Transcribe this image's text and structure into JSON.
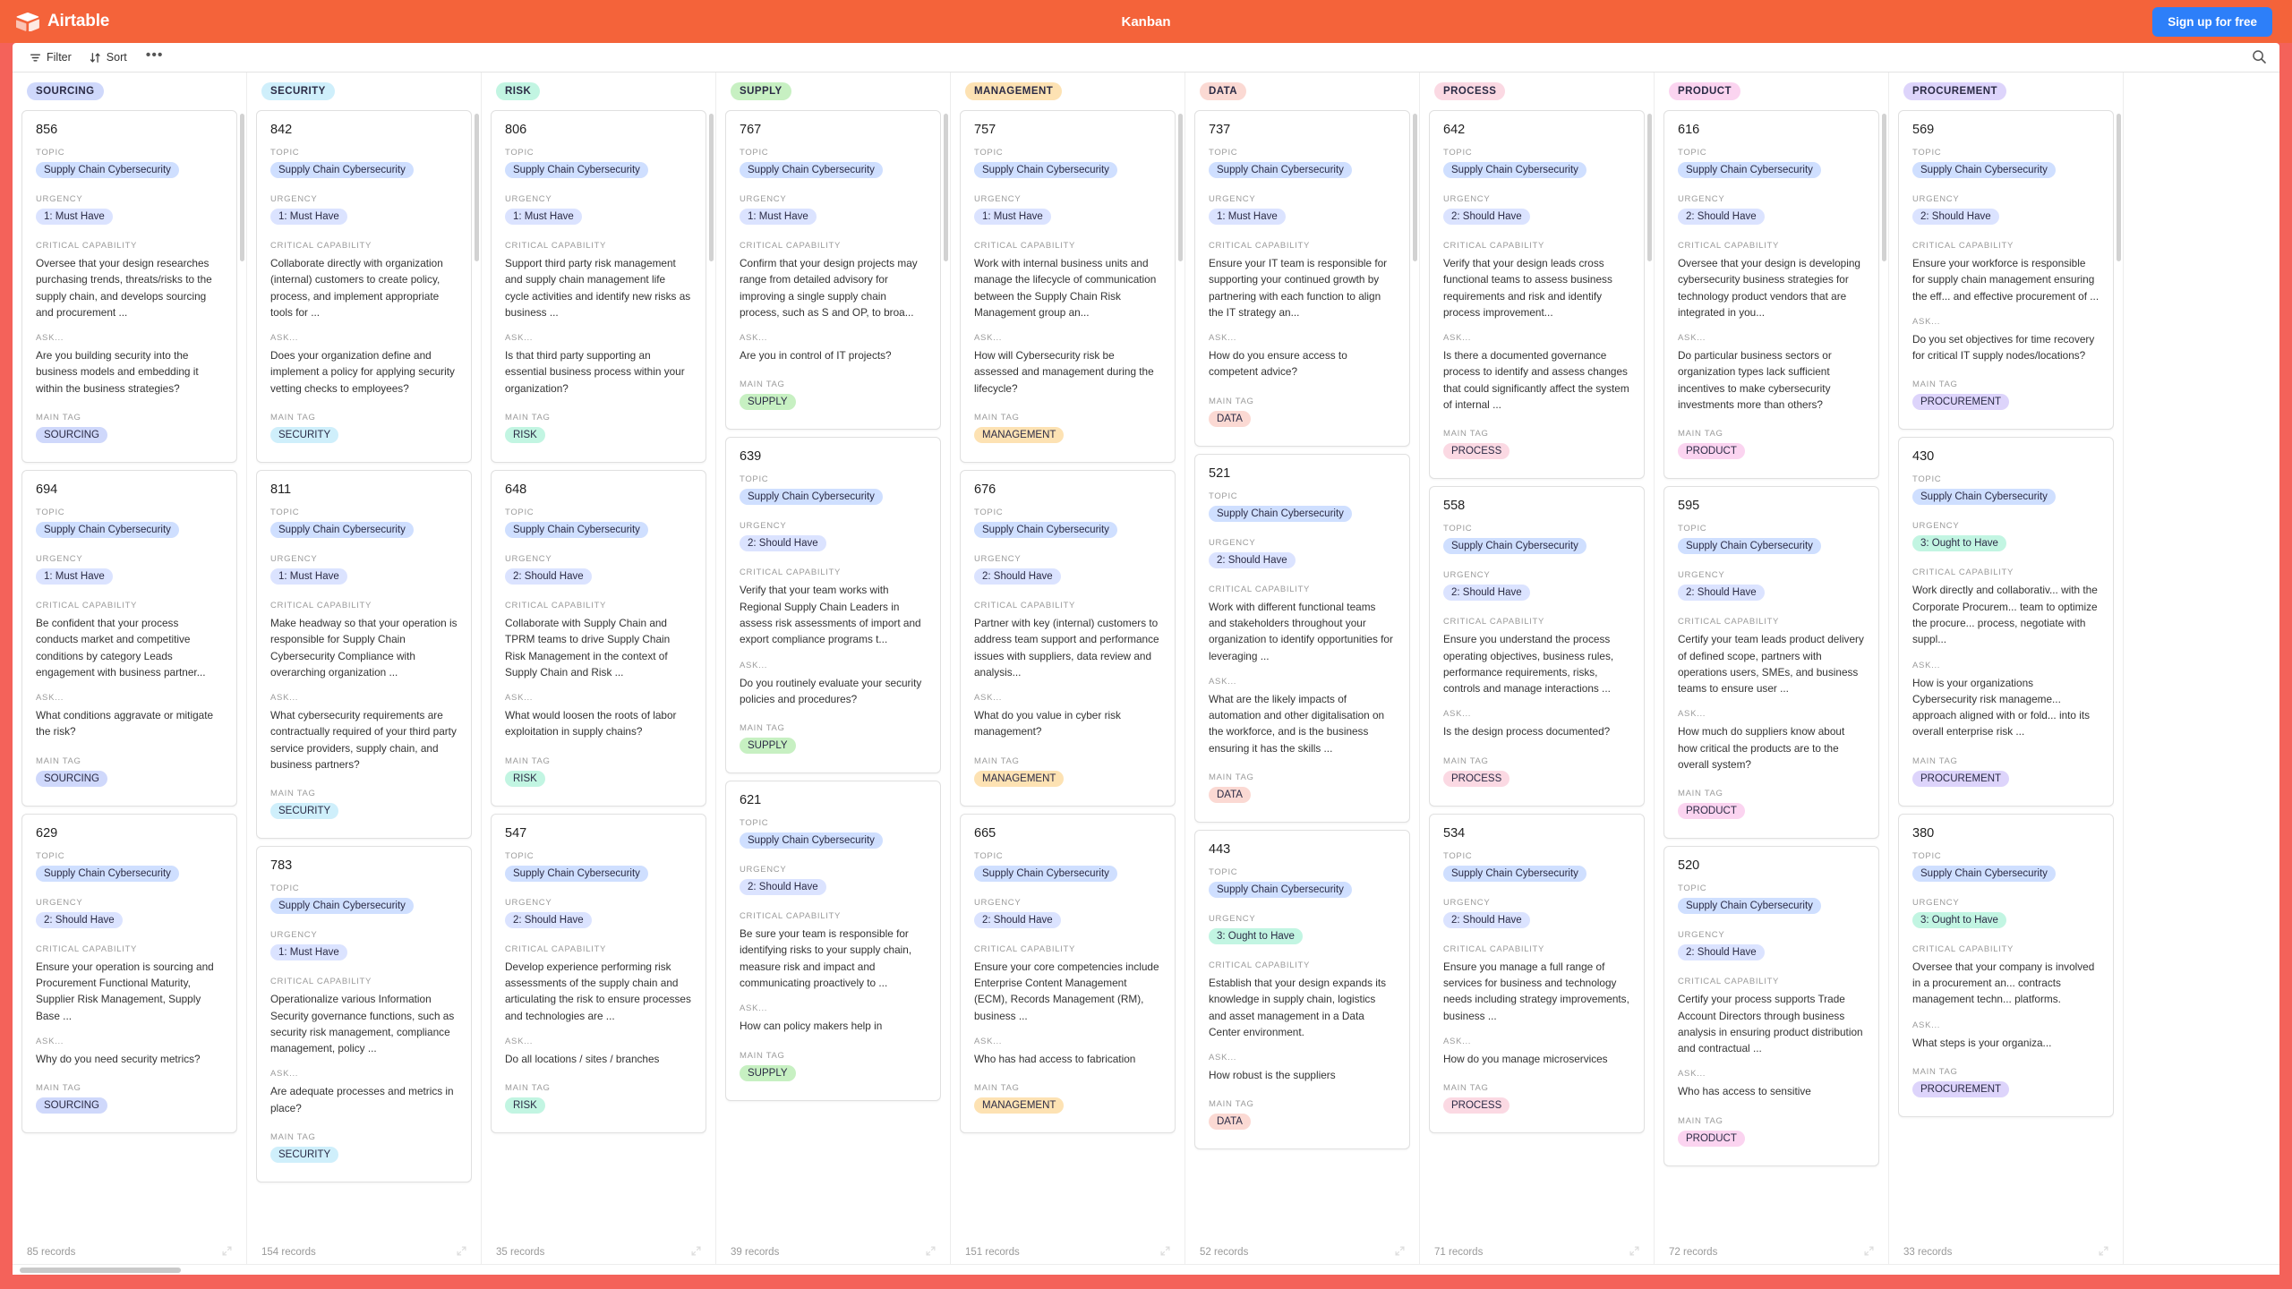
{
  "app": {
    "brand": "Airtable",
    "window_title": "Kanban",
    "signup_label": "Sign up for free",
    "brand_color": "#f4633a",
    "cta_color": "#2d7ff9"
  },
  "toolbar": {
    "filter_label": "Filter",
    "sort_label": "Sort",
    "more_label": "•••",
    "search_icon": "search-icon",
    "filter_icon": "filter-icon",
    "sort_icon": "sort-icon"
  },
  "field_labels": {
    "topic": "TOPIC",
    "urgency": "URGENCY",
    "capability": "CRITICAL CAPABILITY",
    "ask": "ASK...",
    "main_tag": "MAIN TAG"
  },
  "columns": [
    {
      "name": "SOURCING",
      "color": "#cfd8fb",
      "records": "85 records",
      "cards": [
        {
          "id": "856",
          "topic": "Supply Chain Cybersecurity",
          "urgency": "1: Must Have",
          "urgency_level": 1,
          "capability": "Oversee that your design researches purchasing trends, threats/risks to the supply chain, and develops sourcing and procurement ...",
          "ask": "Are you building security into the business models and embedding it within the business strategies?",
          "main_tag": "SOURCING"
        },
        {
          "id": "694",
          "topic": "Supply Chain Cybersecurity",
          "urgency": "1: Must Have",
          "urgency_level": 1,
          "capability": "Be confident that your process conducts market and competitive conditions by category Leads engagement with business partner...",
          "ask": "What conditions aggravate or mitigate the risk?",
          "main_tag": "SOURCING"
        },
        {
          "id": "629",
          "topic": "Supply Chain Cybersecurity",
          "urgency": "2: Should Have",
          "urgency_level": 2,
          "capability": "Ensure your operation is sourcing and Procurement Functional Maturity, Supplier Risk Management, Supply Base ...",
          "ask": "Why do you need security metrics?",
          "main_tag": "SOURCING"
        }
      ]
    },
    {
      "name": "SECURITY",
      "color": "#cfeffb",
      "records": "154 records",
      "cards": [
        {
          "id": "842",
          "topic": "Supply Chain Cybersecurity",
          "urgency": "1: Must Have",
          "urgency_level": 1,
          "capability": "Collaborate directly with organization (internal) customers to create policy, process, and implement appropriate tools for ...",
          "ask": "Does your organization define and implement a policy for applying security vetting checks to employees?",
          "main_tag": "SECURITY"
        },
        {
          "id": "811",
          "topic": "Supply Chain Cybersecurity",
          "urgency": "1: Must Have",
          "urgency_level": 1,
          "capability": "Make headway so that your operation is responsible for Supply Chain Cybersecurity Compliance with overarching organization ...",
          "ask": "What cybersecurity requirements are contractually required of your third party service providers, supply chain, and business partners?",
          "main_tag": "SECURITY"
        },
        {
          "id": "783",
          "topic": "Supply Chain Cybersecurity",
          "urgency": "1: Must Have",
          "urgency_level": 1,
          "capability": "Operationalize various Information Security governance functions, such as security risk management, compliance management, policy ...",
          "ask": "Are adequate processes and metrics in place?",
          "main_tag": "SECURITY"
        }
      ]
    },
    {
      "name": "RISK",
      "color": "#c2f5e2",
      "records": "35 records",
      "cards": [
        {
          "id": "806",
          "topic": "Supply Chain Cybersecurity",
          "urgency": "1: Must Have",
          "urgency_level": 1,
          "capability": "Support third party risk management and supply chain management life cycle activities and identify new risks as business ...",
          "ask": "Is that third party supporting an essential business process within your organization?",
          "main_tag": "RISK"
        },
        {
          "id": "648",
          "topic": "Supply Chain Cybersecurity",
          "urgency": "2: Should Have",
          "urgency_level": 2,
          "capability": "Collaborate with Supply Chain and TPRM teams to drive Supply Chain Risk Management in the context of Supply Chain and Risk ...",
          "ask": "What would loosen the roots of labor exploitation in supply chains?",
          "main_tag": "RISK"
        },
        {
          "id": "547",
          "topic": "Supply Chain Cybersecurity",
          "urgency": "2: Should Have",
          "urgency_level": 2,
          "capability": "Develop experience performing risk assessments of the supply chain and articulating the risk to ensure processes and technologies are ...",
          "ask": "Do all locations / sites / branches",
          "main_tag": "RISK"
        }
      ]
    },
    {
      "name": "SUPPLY",
      "color": "#c7f0c2",
      "records": "39 records",
      "cards": [
        {
          "id": "767",
          "topic": "Supply Chain Cybersecurity",
          "urgency": "1: Must Have",
          "urgency_level": 1,
          "capability": "Confirm that your design projects may range from detailed advisory for improving a single supply chain process, such as S and OP, to broa...",
          "ask": "Are you in control of IT projects?",
          "main_tag": "SUPPLY"
        },
        {
          "id": "639",
          "topic": "Supply Chain Cybersecurity",
          "urgency": "2: Should Have",
          "urgency_level": 2,
          "capability": "Verify that your team works with Regional Supply Chain Leaders in assess risk assessments of import and export compliance programs t...",
          "ask": "Do you routinely evaluate your security policies and procedures?",
          "main_tag": "SUPPLY"
        },
        {
          "id": "621",
          "topic": "Supply Chain Cybersecurity",
          "urgency": "2: Should Have",
          "urgency_level": 2,
          "capability": "Be sure your team is responsible for identifying risks to your supply chain, measure risk and impact and communicating proactively to ...",
          "ask": "How can policy makers help in",
          "main_tag": "SUPPLY"
        }
      ]
    },
    {
      "name": "MANAGEMENT",
      "color": "#fde2b3",
      "records": "151 records",
      "cards": [
        {
          "id": "757",
          "topic": "Supply Chain Cybersecurity",
          "urgency": "1: Must Have",
          "urgency_level": 1,
          "capability": "Work with internal business units and manage the lifecycle of communication between the Supply Chain Risk Management group an...",
          "ask": "How will Cybersecurity risk be assessed and management during the lifecycle?",
          "main_tag": "MANAGEMENT"
        },
        {
          "id": "676",
          "topic": "Supply Chain Cybersecurity",
          "urgency": "2: Should Have",
          "urgency_level": 2,
          "capability": "Partner with key (internal) customers to address team support and performance issues with suppliers, data review and analysis...",
          "ask": "What do you value in cyber risk management?",
          "main_tag": "MANAGEMENT"
        },
        {
          "id": "665",
          "topic": "Supply Chain Cybersecurity",
          "urgency": "2: Should Have",
          "urgency_level": 2,
          "capability": "Ensure your core competencies include Enterprise Content Management (ECM), Records Management (RM), business ...",
          "ask": "Who has had access to fabrication",
          "main_tag": "MANAGEMENT"
        }
      ]
    },
    {
      "name": "DATA",
      "color": "#fbd9d3",
      "records": "52 records",
      "cards": [
        {
          "id": "737",
          "topic": "Supply Chain Cybersecurity",
          "urgency": "1: Must Have",
          "urgency_level": 1,
          "capability": "Ensure your IT team is responsible for supporting your continued growth by partnering with each function to align the IT strategy an...",
          "ask": "How do you ensure access to competent advice?",
          "main_tag": "DATA"
        },
        {
          "id": "521",
          "topic": "Supply Chain Cybersecurity",
          "urgency": "2: Should Have",
          "urgency_level": 2,
          "capability": "Work with different functional teams and stakeholders throughout your organization to identify opportunities for leveraging ...",
          "ask": "What are the likely impacts of automation and other digitalisation on the workforce, and is the business ensuring it has the skills ...",
          "main_tag": "DATA"
        },
        {
          "id": "443",
          "topic": "Supply Chain Cybersecurity",
          "urgency": "3: Ought to Have",
          "urgency_level": 3,
          "capability": "Establish that your design expands its knowledge in supply chain, logistics and asset management in a Data Center environment.",
          "ask": "How robust is the suppliers",
          "main_tag": "DATA"
        }
      ]
    },
    {
      "name": "PROCESS",
      "color": "#fbd9e3",
      "records": "71 records",
      "cards": [
        {
          "id": "642",
          "topic": "Supply Chain Cybersecurity",
          "urgency": "2: Should Have",
          "urgency_level": 2,
          "capability": "Verify that your design leads cross functional teams to assess business requirements and risk and identify process improvement...",
          "ask": "Is there a documented governance process to identify and assess changes that could significantly affect the system of internal ...",
          "main_tag": "PROCESS"
        },
        {
          "id": "558",
          "topic": "Supply Chain Cybersecurity",
          "urgency": "2: Should Have",
          "urgency_level": 2,
          "capability": "Ensure you understand the process operating objectives, business rules, performance requirements, risks, controls and manage interactions ...",
          "ask": "Is the design process documented?",
          "main_tag": "PROCESS"
        },
        {
          "id": "534",
          "topic": "Supply Chain Cybersecurity",
          "urgency": "2: Should Have",
          "urgency_level": 2,
          "capability": "Ensure you manage a full range of services for business and technology needs including strategy improvements, business ...",
          "ask": "How do you manage microservices",
          "main_tag": "PROCESS"
        }
      ]
    },
    {
      "name": "PRODUCT",
      "color": "#fbd4f0",
      "records": "72 records",
      "cards": [
        {
          "id": "616",
          "topic": "Supply Chain Cybersecurity",
          "urgency": "2: Should Have",
          "urgency_level": 2,
          "capability": "Oversee that your design is developing cybersecurity business strategies for technology product vendors that are integrated in you...",
          "ask": "Do particular business sectors or organization types lack sufficient incentives to make cybersecurity investments more than others?",
          "main_tag": "PRODUCT"
        },
        {
          "id": "595",
          "topic": "Supply Chain Cybersecurity",
          "urgency": "2: Should Have",
          "urgency_level": 2,
          "capability": "Certify your team leads product delivery of defined scope, partners with operations users, SMEs, and business teams to ensure user ...",
          "ask": "How much do suppliers know about how critical the products are to the overall system?",
          "main_tag": "PRODUCT"
        },
        {
          "id": "520",
          "topic": "Supply Chain Cybersecurity",
          "urgency": "2: Should Have",
          "urgency_level": 2,
          "capability": "Certify your process supports Trade Account Directors through business analysis in ensuring product distribution and contractual ...",
          "ask": "Who has access to sensitive",
          "main_tag": "PRODUCT"
        }
      ]
    },
    {
      "name": "PROCUREMENT",
      "color": "#ddd4fb",
      "records": "33 records",
      "cards": [
        {
          "id": "569",
          "topic": "Supply Chain Cybersecurity",
          "urgency": "2: Should Have",
          "urgency_level": 2,
          "capability": "Ensure your workforce is responsible for supply chain management ensuring the eff... and effective procurement of ...",
          "ask": "Do you set objectives for time recovery for critical IT supply nodes/locations?",
          "main_tag": "PROCUREMENT"
        },
        {
          "id": "430",
          "topic": "Supply Chain Cybersecurity",
          "urgency": "3: Ought to Have",
          "urgency_level": 3,
          "capability": "Work directly and collaborativ... with the Corporate Procurem... team to optimize the procure... process, negotiate with suppl...",
          "ask": "How is your organizations Cybersecurity risk manageme... approach aligned with or fold... into its overall enterprise risk ...",
          "main_tag": "PROCUREMENT"
        },
        {
          "id": "380",
          "topic": "Supply Chain Cybersecurity",
          "urgency": "3: Ought to Have",
          "urgency_level": 3,
          "capability": "Oversee that your company is involved in a procurement an... contracts management techn... platforms.",
          "ask": "What steps is your organiza...",
          "main_tag": "PROCUREMENT"
        }
      ]
    }
  ]
}
